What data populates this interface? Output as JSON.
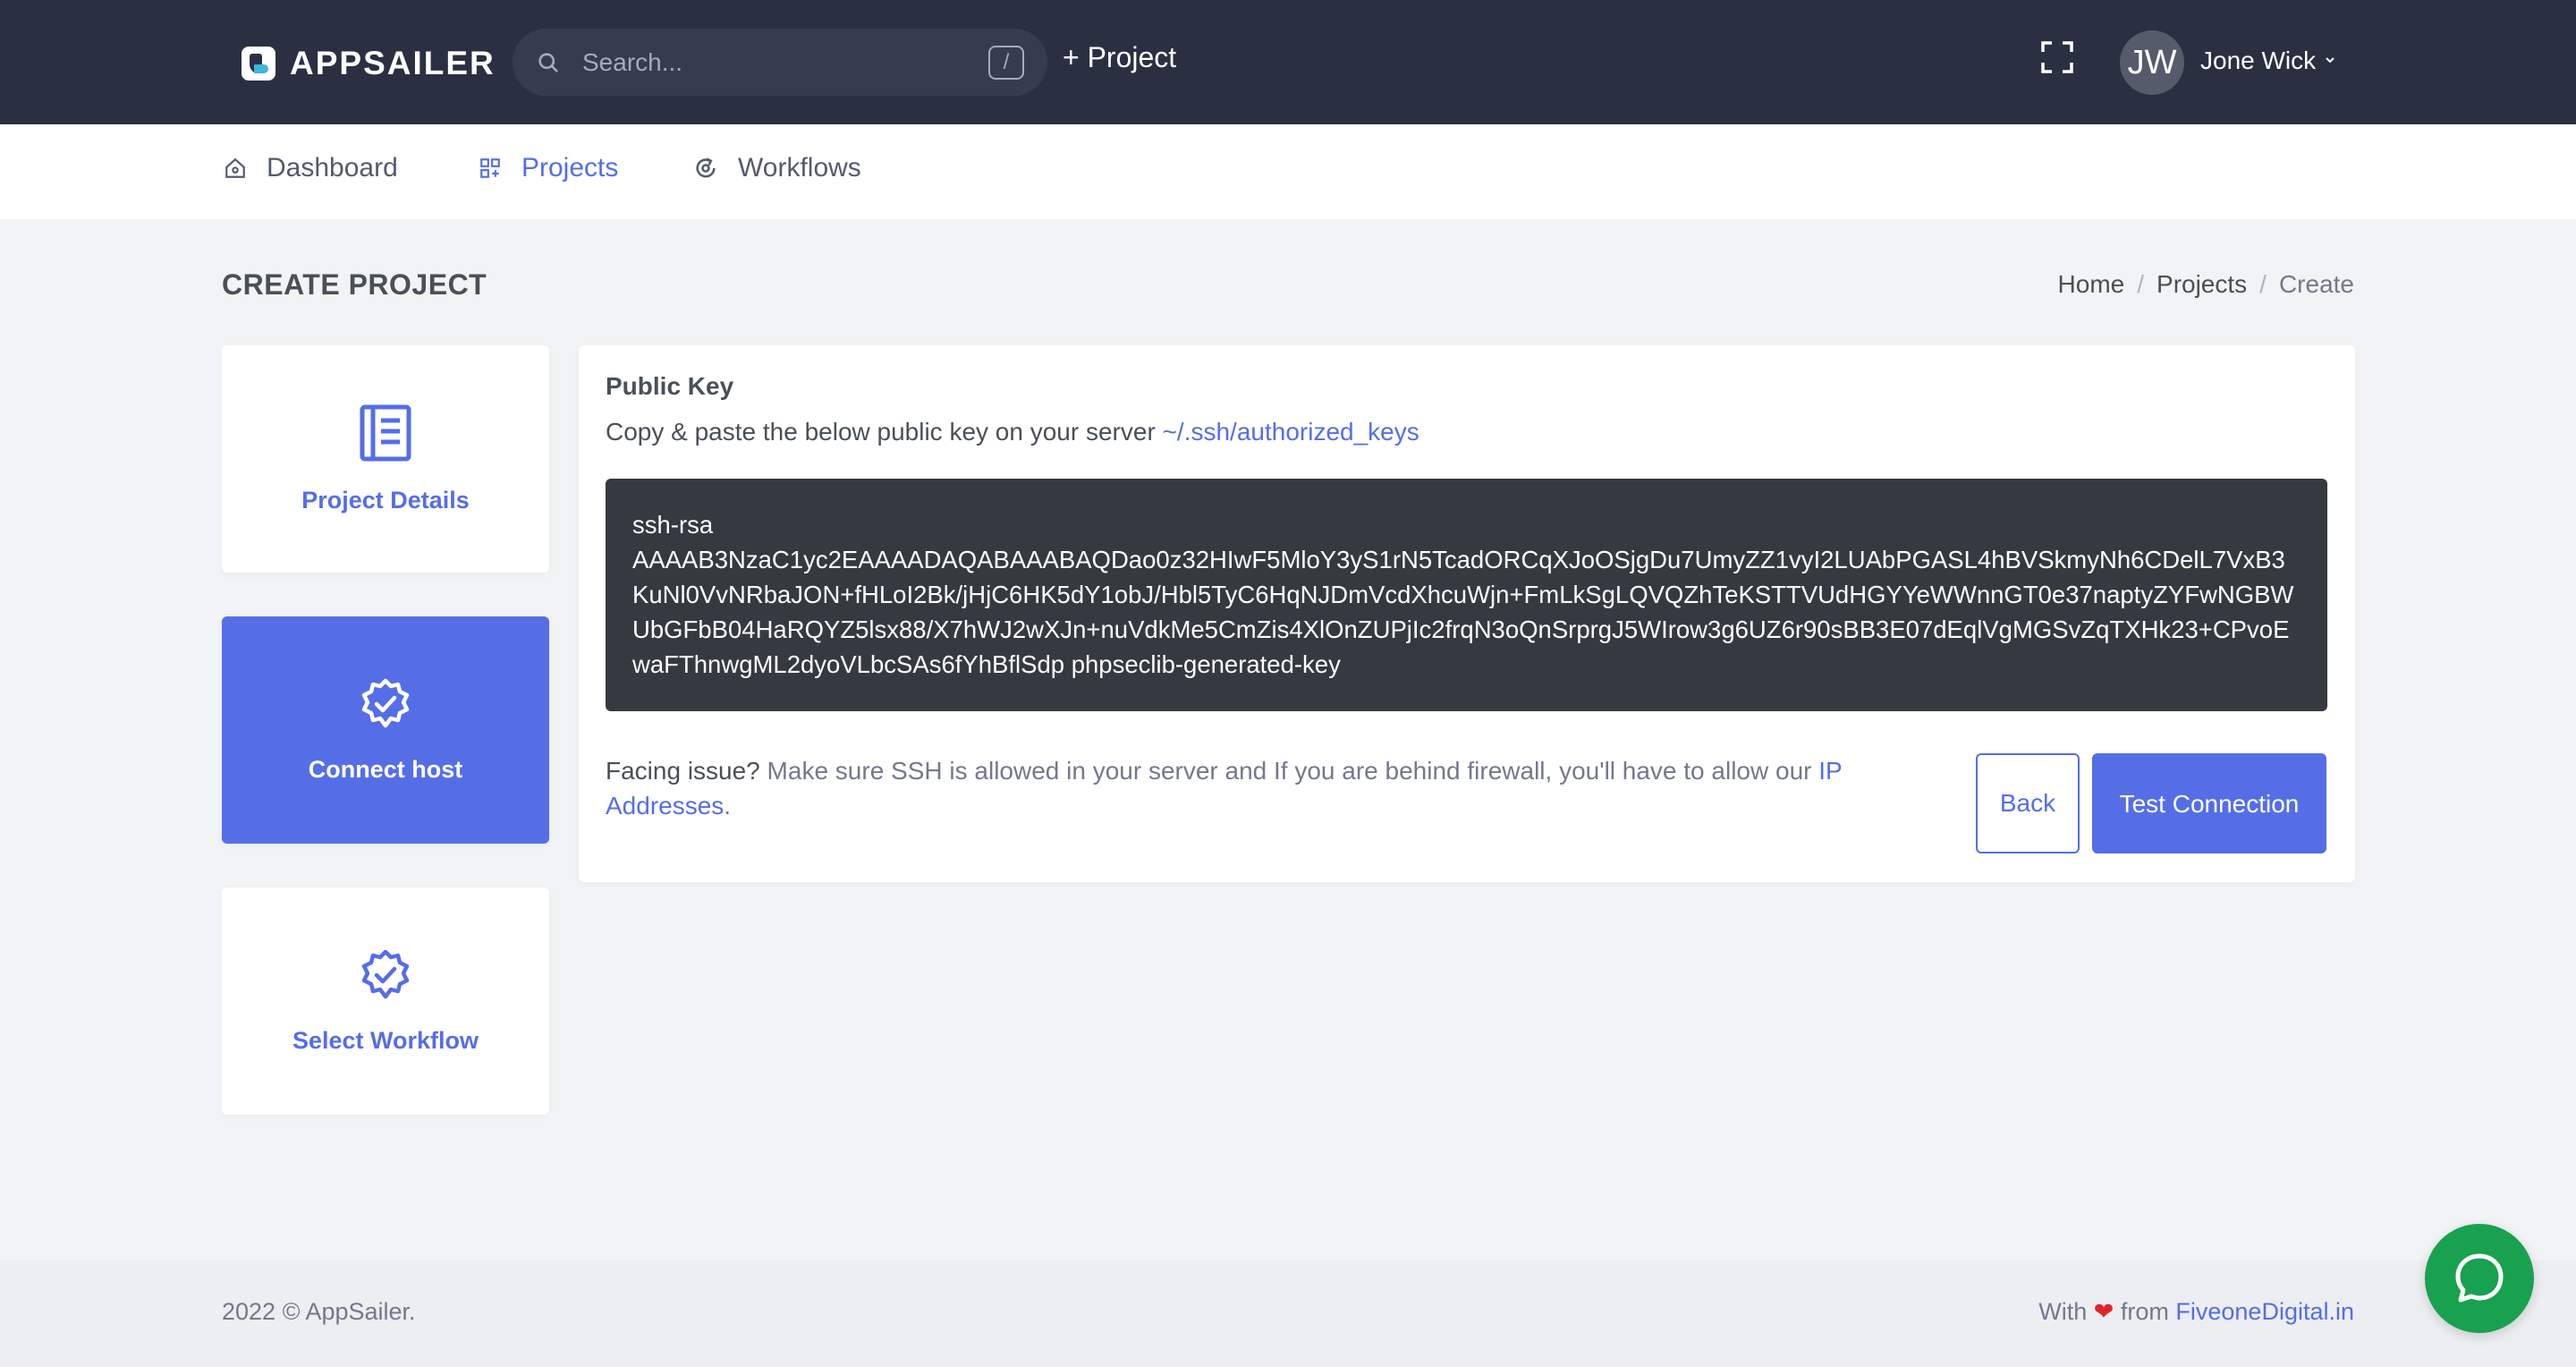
{
  "app": {
    "name": "APPSAILER"
  },
  "search": {
    "placeholder": "Search...",
    "shortcut": "/"
  },
  "header": {
    "new_project_label": "+ Project",
    "user_initials": "JW",
    "user_name": "Jone Wick"
  },
  "nav": {
    "items": [
      {
        "label": "Dashboard",
        "icon": "home-icon",
        "active": false
      },
      {
        "label": "Projects",
        "icon": "grid-icon",
        "active": true
      },
      {
        "label": "Workflows",
        "icon": "sync-icon",
        "active": false
      }
    ]
  },
  "page": {
    "title": "CREATE PROJECT",
    "breadcrumb": [
      "Home",
      "Projects",
      "Create"
    ]
  },
  "steps": [
    {
      "label": "Project Details",
      "icon": "document-icon",
      "active": false
    },
    {
      "label": "Connect host",
      "icon": "badge-check-icon",
      "active": true
    },
    {
      "label": "Select Workflow",
      "icon": "badge-check-icon",
      "active": false
    }
  ],
  "public_key": {
    "title": "Public Key",
    "instruction": "Copy & paste the below public key on your server",
    "path_link": "~/.ssh/authorized_keys",
    "key_type": "ssh-rsa",
    "key_value": "AAAAB3NzaC1yc2EAAAADAQABAAABAQDao0z32HIwF5MloY3yS1rN5TcadORCqXJoOSjgDu7UmyZZ1vyI2LUAbPGASL4hBVSkmyNh6CDelL7VxB3KuNl0VvNRbaJON+fHLoI2Bk/jHjC6HK5dY1obJ/Hbl5TyC6HqNJDmVcdXhcuWjn+FmLkSgLQVQZhTeKSTTVUdHGYYeWWnnGT0e37naptyZYFwNGBWUbGFbB04HaRQYZ5lsx88/X7hWJ2wXJn+nuVdkMe5CmZis4XlOnZUPjIc2frqN3oQnSrprgJ5WIrow3g6UZ6r90sBB3E07dEqlVgMGSvZqTXHk23+CPvoEwaFThnwgML2dyoVLbcSAs6fYhBflSdp",
    "key_comment": "phpseclib-generated-key"
  },
  "issue": {
    "lead": "Facing issue?",
    "text": "Make sure SSH is allowed in your server and If you are behind firewall, you'll have to allow our",
    "link": "IP Addresses",
    "tail": "."
  },
  "actions": {
    "back_label": "Back",
    "test_label": "Test Connection"
  },
  "footer": {
    "copyright": "2022 © AppSailer.",
    "with": "With",
    "from": "from",
    "company": "FiveoneDigital.in"
  },
  "colors": {
    "primary": "#556ee6",
    "topbar": "#2a3042",
    "chat": "#18a14f",
    "key_bg": "#343a40"
  }
}
